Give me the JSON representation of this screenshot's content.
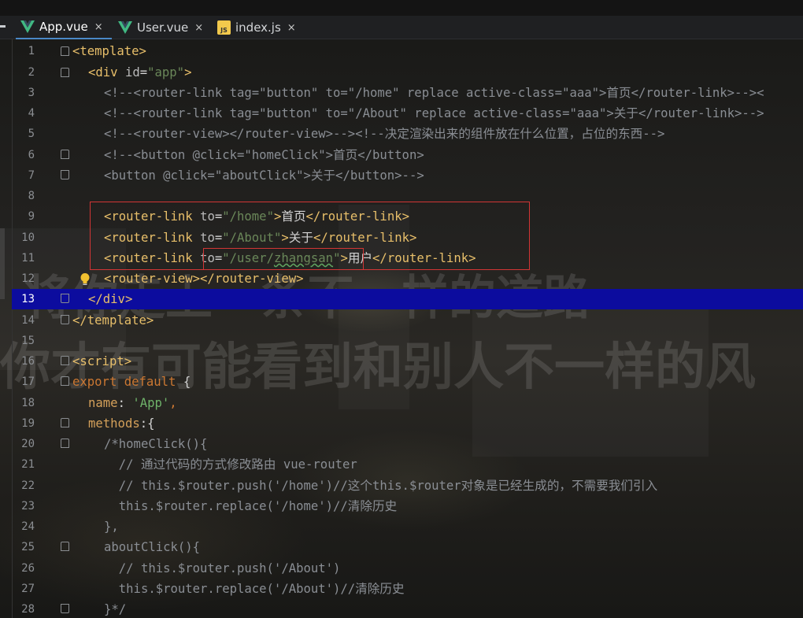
{
  "tabs": [
    {
      "label": "App.vue",
      "icon": "vue-logo-icon",
      "active": true
    },
    {
      "label": "User.vue",
      "icon": "vue-logo-icon",
      "active": false
    },
    {
      "label": "index.js",
      "icon": "js-file-icon",
      "active": false
    }
  ],
  "tab_close_glyph": "×",
  "watermark": {
    "line1": "将你走上一条不一样的道路",
    "line2": "你才有可能看到和别人不一样的风"
  },
  "line_numbers": [
    "1",
    "2",
    "3",
    "4",
    "5",
    "6",
    "7",
    "8",
    "9",
    "10",
    "11",
    "12",
    "13",
    "14",
    "15",
    "16",
    "17",
    "18",
    "19",
    "20",
    "21",
    "22",
    "23",
    "24",
    "25",
    "26",
    "27",
    "28"
  ],
  "current_line": "13",
  "code": {
    "l1": {
      "tag": "<template>"
    },
    "l2": {
      "open": "<div ",
      "attr": "id",
      "eq": "=",
      "val": "\"app\"",
      "close": ">"
    },
    "l3": {
      "text": "<!--<router-link tag=\"button\" to=\"/home\" replace active-class=\"aaa\">首页</router-link>--><"
    },
    "l4": {
      "text": "<!--<router-link tag=\"button\" to=\"/About\" replace active-class=\"aaa\">关于</router-link>-->"
    },
    "l5": {
      "text": "<!--<router-view></router-view>--><!--决定渲染出来的组件放在什么位置，占位的东西-->"
    },
    "l6": {
      "text": "<!--<button @click=\"homeClick\">首页</button>"
    },
    "l7": {
      "text": "<button @click=\"aboutClick\">关于</button>-->"
    },
    "l9": {
      "open": "<router-link ",
      "attr": "to",
      "eq": "=",
      "val": "\"/home\"",
      "gt": ">",
      "label": "首页",
      "close": "</router-link>"
    },
    "l10": {
      "open": "<router-link ",
      "attr": "to",
      "eq": "=",
      "val": "\"/About\"",
      "gt": ">",
      "label": "关于",
      "close": "</router-link>"
    },
    "l11": {
      "open": "<router-link ",
      "attr": "to",
      "eq": "=",
      "val_a": "\"/user/",
      "val_b": "zhangsan",
      "val_c": "\"",
      "gt": ">",
      "label": "用户",
      "close": "</router-link>"
    },
    "l12": {
      "tag": "<router-view></router-view>"
    },
    "l13": {
      "tag": "</div>"
    },
    "l14": {
      "tag": "</template>"
    },
    "l16": {
      "tag": "<script>"
    },
    "l17": {
      "kw": "export default ",
      "rest": "{"
    },
    "l18": {
      "key": "name",
      "colon": ": ",
      "val": "'App'",
      "comma": ","
    },
    "l19": {
      "key": "methods",
      "rest": ":{"
    },
    "l20": {
      "text": "/*homeClick(){"
    },
    "l21": {
      "text": "  // 通过代码的方式修改路由 vue-router"
    },
    "l22": {
      "text": "  // this.$router.push('/home')//这个this.$router对象是已经生成的，不需要我们引入"
    },
    "l23": {
      "text": "  this.$router.replace('/home')//清除历史"
    },
    "l24": {
      "text": "},"
    },
    "l25": {
      "text": "aboutClick(){"
    },
    "l26": {
      "text": "  // this.$router.push('/About')"
    },
    "l27": {
      "text": "  this.$router.replace('/About')//清除历史"
    },
    "l28": {
      "text": "}*/"
    }
  },
  "colors": {
    "tag": "#e8bf6a",
    "attribute": "#bababa",
    "string": "#6a8759",
    "comment": "#8a8e94",
    "keyword": "#cc7832",
    "current_line": "#0c0c9e",
    "highlight_box": "#d23535",
    "active_tab_underline": "#4a88c7"
  }
}
